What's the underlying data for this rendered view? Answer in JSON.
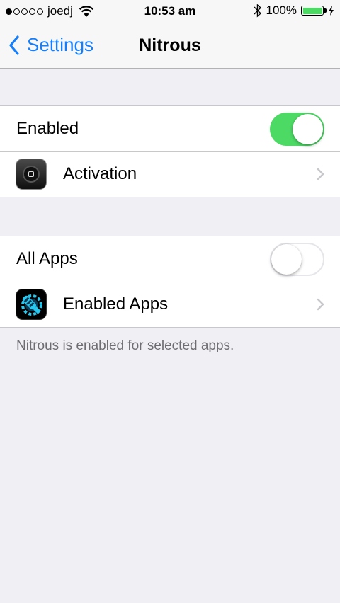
{
  "status_bar": {
    "carrier": "joedj",
    "time": "10:53 am",
    "battery_percent": "100%",
    "signal_bars_filled": 1,
    "signal_bars_total": 5,
    "battery_level": 1.0,
    "icons": [
      "wifi-icon",
      "bluetooth-icon",
      "battery-icon",
      "charging-bolt-icon"
    ]
  },
  "nav": {
    "back_label": "Settings",
    "title": "Nitrous"
  },
  "group1": {
    "enabled_label": "Enabled",
    "enabled_on": true,
    "activation_label": "Activation"
  },
  "group2": {
    "all_apps_label": "All Apps",
    "all_apps_on": false,
    "enabled_apps_label": "Enabled Apps"
  },
  "footer": "Nitrous is enabled for selected apps.",
  "colors": {
    "accent": "#157efb",
    "toggle_on": "#4cd964",
    "background": "#efeff4"
  }
}
